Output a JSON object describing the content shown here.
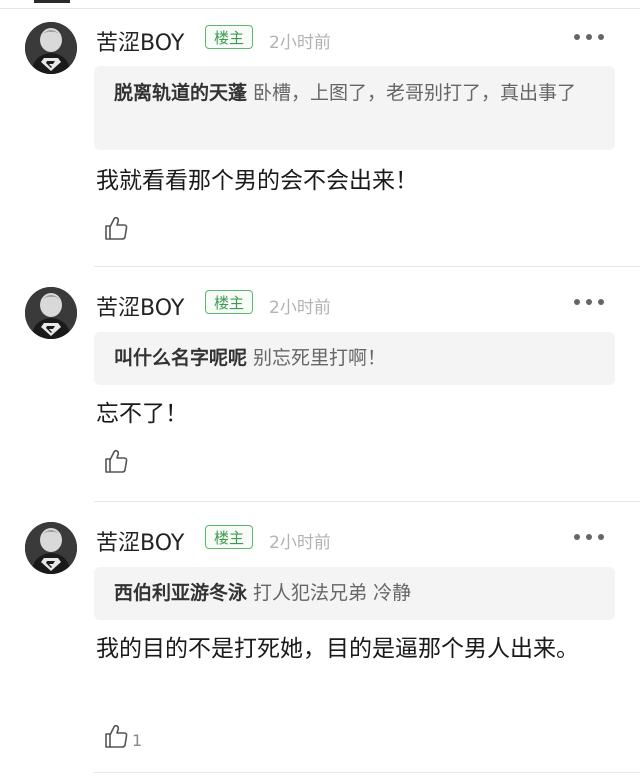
{
  "comments": [
    {
      "username": "苦涩BOY",
      "badge": "楼主",
      "time": "2小时前",
      "quote_user": "脱离轨道的天蓬",
      "quote_text": " 卧槽，上图了，老哥别打了，真出事了",
      "body": "我就看看那个男的会不会出来！",
      "likes": ""
    },
    {
      "username": "苦涩BOY",
      "badge": "楼主",
      "time": "2小时前",
      "quote_user": "叫什么名字呢呢",
      "quote_text": " 别忘死里打啊！",
      "body": "忘不了！",
      "likes": ""
    },
    {
      "username": "苦涩BOY",
      "badge": "楼主",
      "time": "2小时前",
      "quote_user": "西伯利亚游冬泳",
      "quote_text": " 打人犯法兄弟 冷静",
      "body": "我的目的不是打死她，目的是逼那个男人出来。",
      "likes": "1"
    }
  ],
  "colors": {
    "badge_green": "#3d9b50",
    "time_gray": "#b2b2b2",
    "quote_bg": "#f4f4f4"
  },
  "icons": {
    "avatar": "superman-avatar",
    "more": "more-dots-icon",
    "like": "thumbs-up-icon"
  }
}
